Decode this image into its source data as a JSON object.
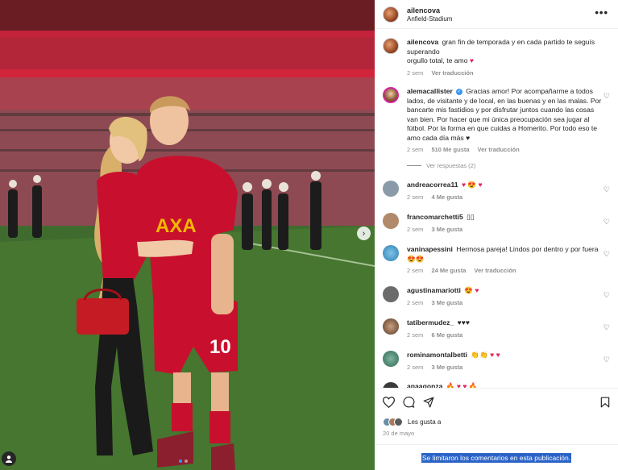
{
  "post": {
    "username": "ailencova",
    "location": "Anfield-Stadium",
    "more": "•••",
    "caption_user": "ailencova",
    "caption_line1": "gran fin de temporada y en cada partido te seguís superando",
    "caption_line2": "orgullo total, te amo",
    "caption_time": "2 sem",
    "caption_translate": "Ver traducción"
  },
  "comments": [
    {
      "user": "alemacallister",
      "verified": "✓",
      "text": "Gracias amor! Por acompañarme a todos lados, de visitante y de local, en las buenas y en las malas. Por bancarte mis fastidios y por disfrutar juntos cuando las cosas van bien. Por hacer que mi única preocupación sea jugar al fútbol. Por la forma en que cuidas a Homerito. Por todo eso te amo cada día más ♥",
      "time": "2 sem",
      "likes": "510 Me gusta",
      "translate": "Ver traducción"
    },
    {
      "user": "andreacorrea11",
      "text": "♥ 😍 ♥",
      "time": "2 sem",
      "likes": "4 Me gusta"
    },
    {
      "user": "francomarchetti5",
      "text": "▯▯",
      "time": "2 sem",
      "likes": "3 Me gusta"
    },
    {
      "user": "vaninapessini",
      "text": "Hermosa pareja! Lindos por dentro y por fuera 😍😍",
      "time": "2 sem",
      "likes": "24 Me gusta",
      "translate": "Ver traducción"
    },
    {
      "user": "agustinamariotti",
      "text": "😍 ♥",
      "time": "2 sem",
      "likes": "3 Me gusta"
    },
    {
      "user": "tatibermudez_",
      "text": "♥♥♥",
      "time": "2 sem",
      "likes": "6 Me gusta"
    },
    {
      "user": "rominamontalbetti",
      "text": "👏👏 ♥ ♥",
      "time": "2 sem",
      "likes": "3 Me gusta"
    },
    {
      "user": "anaagonza",
      "text": "🔥 ♥ ♥ 🔥",
      "time": "",
      "likes": ""
    }
  ],
  "replies_label": "Ver respuestas (2)",
  "footer": {
    "likes_text": "Les gusta a",
    "date": "20 de mayo",
    "limited": "Se limitaron los comentarios en esta publicación."
  },
  "jersey": {
    "sponsor": "AXA",
    "number": "10"
  },
  "colors": {
    "accent_blue": "#3897f0",
    "heart_red": "#e0245e",
    "kit_red": "#c8102e",
    "footer_highlight": "#2a63c8"
  },
  "icons": [
    "heart-icon",
    "comment-icon",
    "share-icon",
    "bookmark-icon",
    "more-icon",
    "chevron-right-icon",
    "user-tag-icon",
    "verified-icon"
  ]
}
